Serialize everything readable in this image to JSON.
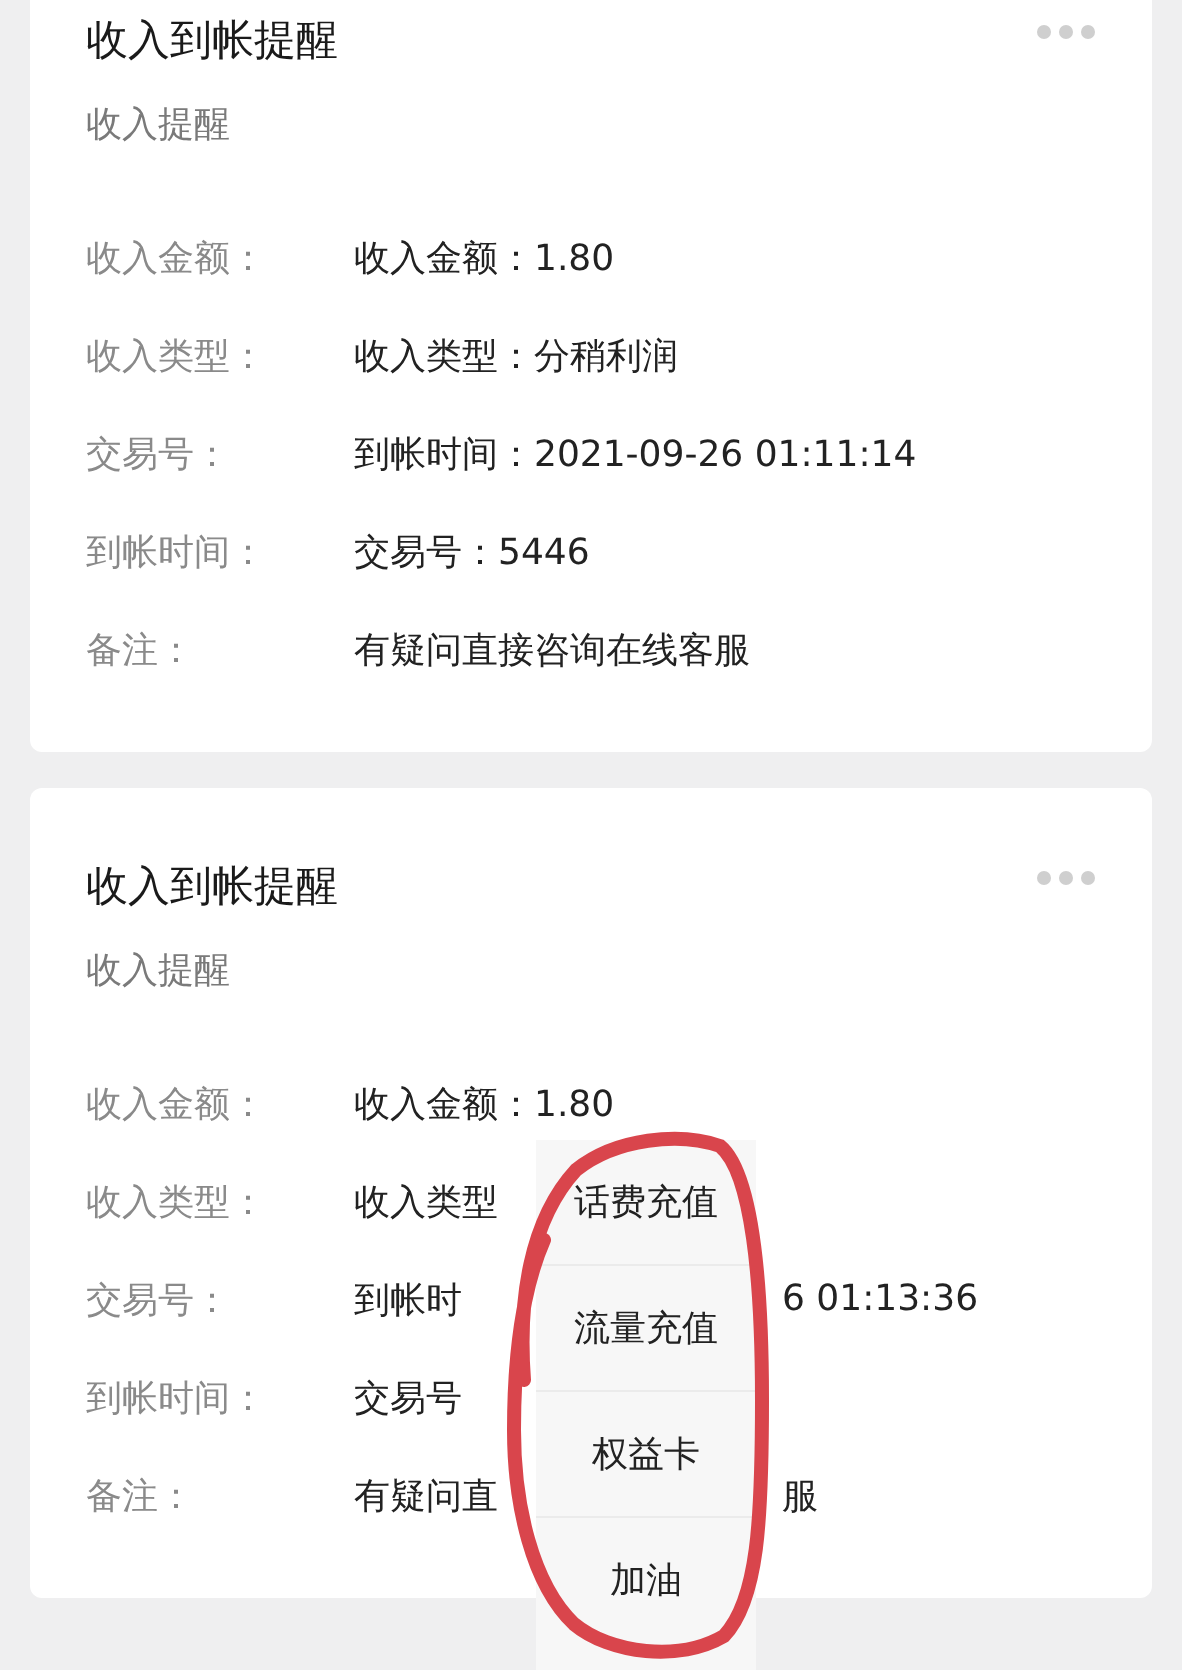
{
  "cards": [
    {
      "title": "收入到帐提醒",
      "subtitle": "收入提醒",
      "rows": [
        {
          "label": "收入金额：",
          "value": "收入金额：1.80"
        },
        {
          "label": "收入类型：",
          "value": "收入类型：分稍利润"
        },
        {
          "label": "交易号：",
          "value": "到帐时间：2021-09-26 01:11:14"
        },
        {
          "label": "到帐时间：",
          "value": "交易号：5446"
        },
        {
          "label": "备注：",
          "value": "有疑问直接咨询在线客服"
        }
      ]
    },
    {
      "title": "收入到帐提醒",
      "subtitle": "收入提醒",
      "rows": [
        {
          "label": "收入金额：",
          "value": "收入金额：1.80"
        },
        {
          "label": "收入类型：",
          "value": "收入类型"
        },
        {
          "label": "交易号：",
          "value": "到帐时",
          "after": "6 01:13:36"
        },
        {
          "label": "到帐时间：",
          "value": "交易号"
        },
        {
          "label": "备注：",
          "value": "有疑问直",
          "after": "服"
        }
      ]
    }
  ],
  "menu": {
    "items": [
      "话费充值",
      "流量充值",
      "权益卡",
      "加油"
    ]
  }
}
